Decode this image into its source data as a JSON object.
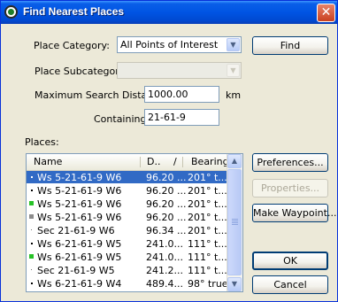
{
  "window": {
    "title": "Find Nearest Places",
    "close_glyph": "✕"
  },
  "form": {
    "category_label": "Place Category:",
    "category_value": "All Points of Interest",
    "subcategory_label": "Place Subcategory:",
    "subcategory_value": "",
    "distance_label": "Maximum Search Distance:",
    "distance_value": "1000.00",
    "distance_unit": "km",
    "containing_label": "Containing:",
    "containing_value": "21-61-9"
  },
  "places": {
    "label": "Places:",
    "columns": {
      "name": "Name",
      "distance": "D..",
      "sort_glyph": "/",
      "bearing": "Bearing"
    },
    "rows": [
      {
        "marker": "dot",
        "name": "Ws 5-21-61-9 W6",
        "distance": "96.20 ...",
        "bearing": "201° t...",
        "selected": true
      },
      {
        "marker": "dot",
        "name": "Ws 5-21-61-9 W6",
        "distance": "96.20 ...",
        "bearing": "201° t...",
        "selected": false
      },
      {
        "marker": "green-square",
        "name": "Ws 5-21-61-9 W6",
        "distance": "96.20 ...",
        "bearing": "201° t...",
        "selected": false
      },
      {
        "marker": "gray-square",
        "name": "Ws 5-21-61-9 W6",
        "distance": "96.20 ...",
        "bearing": "201° t...",
        "selected": false
      },
      {
        "marker": "small-dot",
        "name": "Sec 21-61-9 W6",
        "distance": "96.34 ...",
        "bearing": "201° t...",
        "selected": false
      },
      {
        "marker": "dot",
        "name": "Ws 6-21-61-9 W5",
        "distance": "241.0...",
        "bearing": "111° t...",
        "selected": false
      },
      {
        "marker": "green-square",
        "name": "Ws 6-21-61-9 W5",
        "distance": "241.0...",
        "bearing": "111° t...",
        "selected": false
      },
      {
        "marker": "small-dot",
        "name": "Sec 21-61-9 W5",
        "distance": "241.2...",
        "bearing": "111° t...",
        "selected": false
      },
      {
        "marker": "dot",
        "name": "Ws 6-21-61-9 W4",
        "distance": "489.4...",
        "bearing": "98° true",
        "selected": false
      }
    ]
  },
  "buttons": {
    "find": "Find",
    "preferences": "Preferences...",
    "properties": "Properties...",
    "make_waypoint": "Make Waypoint...",
    "ok": "OK",
    "cancel": "Cancel"
  },
  "icons": {
    "title": "globe-icon",
    "dropdown": "chevron-down-icon",
    "scroll_up": "arrow-up-icon",
    "scroll_down": "arrow-down-icon"
  },
  "colors": {
    "titlebar": "#0054e3",
    "selection": "#316ac5",
    "dialog_bg": "#ece9d8",
    "close_button": "#c9401f",
    "green_marker": "#27c227",
    "gray_marker": "#8c8c8c"
  }
}
